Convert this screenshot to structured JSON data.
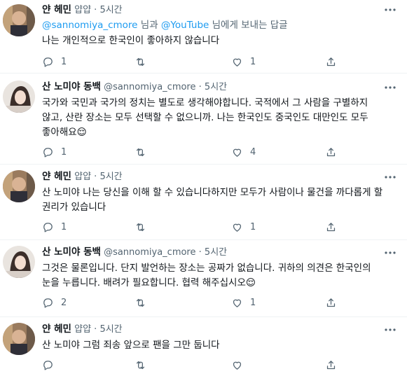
{
  "tweets": [
    {
      "name": "얀 헤민",
      "handle": "얍얍",
      "time": "5시간",
      "reply_to": {
        "prefix": "",
        "mention1": "@sannomiya_cmore",
        "mid": " 님과 ",
        "mention2": "@YouTube",
        "suffix": " 님에게 보내는 답글"
      },
      "text": "나는 개인적으로 한국인이 좋아하지 않습니다",
      "reply_count": "1",
      "retweet_count": "",
      "like_count": "1"
    },
    {
      "name": "산 노미야 동백",
      "handle": "@sannomiya_cmore",
      "time": "5시간",
      "text": "국가와 국민과 국가의 정치는 별도로 생각해야합니다. 국적에서 그 사람을 구별하지 않고, 산란 장소는 모두 선택할 수 없으니까. 나는 한국인도 중국인도 대만인도 모두 좋아해요😌",
      "reply_count": "1",
      "retweet_count": "",
      "like_count": "4"
    },
    {
      "name": "얀 헤민",
      "handle": "얍얍",
      "time": "5시간",
      "text": "산 노미야 나는 당신을 이해 할 수 있습니다하지만 모두가 사람이나 물건을 까다롭게 할 권리가 있습니다",
      "reply_count": "1",
      "retweet_count": "",
      "like_count": "1"
    },
    {
      "name": "산 노미야 동백",
      "handle": "@sannomiya_cmore",
      "time": "5시간",
      "text": "그것은 물론입니다. 단지 발언하는 장소는 공짜가 없습니다. 귀하의 의견은 한국인의 눈을 누릅니다. 배려가 필요합니다. 협력 해주십시오😌",
      "reply_count": "2",
      "retweet_count": "",
      "like_count": "1"
    },
    {
      "name": "얀 헤민",
      "handle": "얍얍",
      "time": "5시간",
      "text": "산 노미야 그럼 죄송 앞으로 팬을 그만 둡니다",
      "reply_count": "",
      "retweet_count": "",
      "like_count": ""
    }
  ],
  "separator": "·",
  "icons": {
    "reply": "reply-icon",
    "retweet": "retweet-icon",
    "like": "heart-icon",
    "share": "share-icon",
    "more": "more-icon"
  },
  "colors": {
    "accent": "#1d9bf0",
    "secondary_text": "#536471",
    "thread_line": "#cfd9de"
  }
}
